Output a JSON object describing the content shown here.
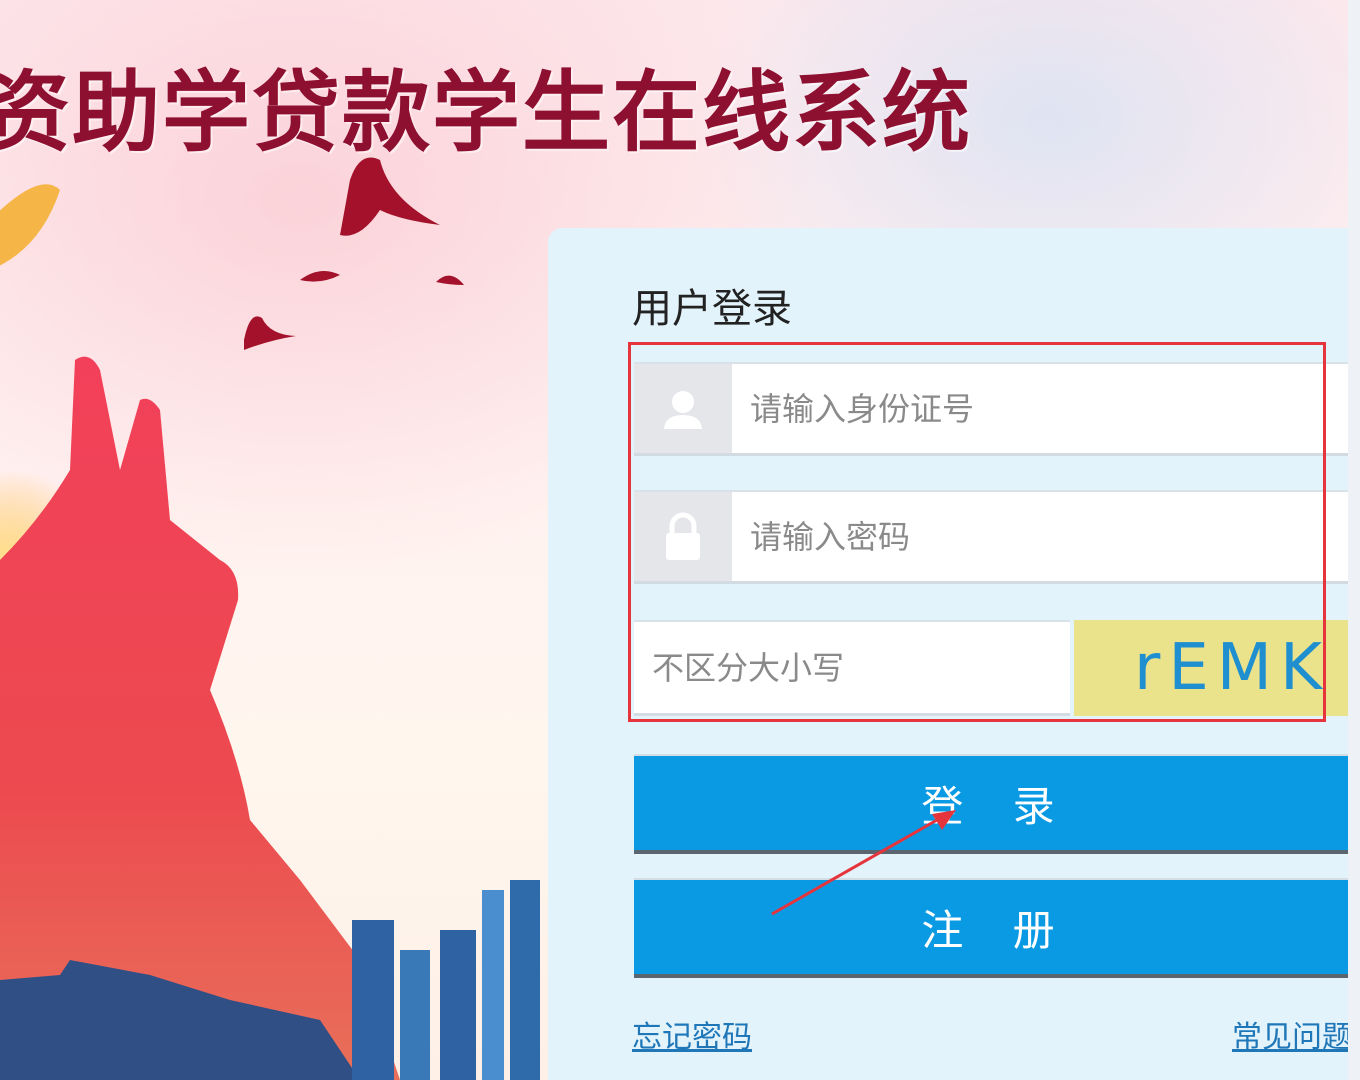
{
  "page": {
    "headline": "资助学贷款学生在线系统"
  },
  "login_panel": {
    "title": "用户登录",
    "id_field": {
      "placeholder": "请输入身份证号",
      "value": "",
      "icon": "user-icon"
    },
    "password_field": {
      "placeholder": "请输入密码",
      "value": "",
      "icon": "lock-icon"
    },
    "captcha_field": {
      "placeholder": "不区分大小写",
      "value": ""
    },
    "captcha_code": "rEMK",
    "login_button": "登 录",
    "register_button": "注 册",
    "forgot_password_link": "忘记密码",
    "faq_link": "常见问题"
  },
  "colors": {
    "primary_button": "#0a9ae4",
    "panel_bg": "#e3f3fb",
    "headline": "#8e1030",
    "annotation": "#e5343c",
    "captcha_bg": "#ebe28c",
    "captcha_text": "#1f8fd0"
  }
}
